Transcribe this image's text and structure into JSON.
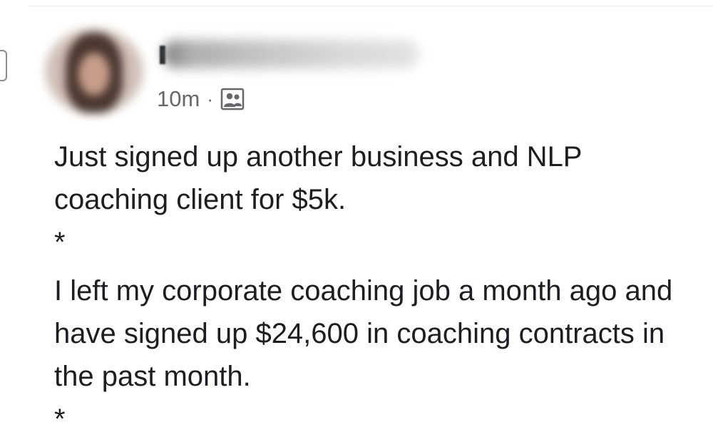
{
  "post": {
    "timestamp": "10m",
    "separator": "·",
    "audience_icon": "friends-icon",
    "paragraphs": [
      "Just signed up another business and NLP coaching client for $5k.",
      "*",
      "I left my corporate coaching job a month ago and have signed up $24,600 in coaching contracts in the past month.",
      "*"
    ]
  },
  "colors": {
    "text_primary": "#1c1e21",
    "text_secondary": "#65676b",
    "background": "#ffffff"
  }
}
